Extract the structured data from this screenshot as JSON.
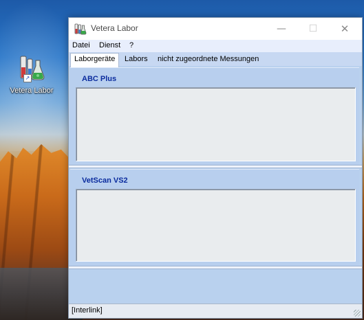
{
  "desktop": {
    "icon_label": "Vetera Labor"
  },
  "window": {
    "title": "Vetera Labor",
    "controls": {
      "minimize": "—",
      "maximize": "☐",
      "close": "✕"
    }
  },
  "menu": {
    "items": [
      "Datei",
      "Dienst",
      "?"
    ]
  },
  "tabs": {
    "items": [
      "Laborgeräte",
      "Labors",
      "nicht zugeordnete Messungen"
    ],
    "active": "Laborgeräte"
  },
  "panels": [
    {
      "title": "ABC Plus"
    },
    {
      "title": "VetScan VS2"
    }
  ],
  "status": {
    "text": "[Interlink]"
  },
  "icons": {
    "desktop_shortcut": "lab-flask-icon",
    "shortcut_overlay": "shortcut-arrow-icon",
    "window_app": "lab-flask-icon"
  }
}
